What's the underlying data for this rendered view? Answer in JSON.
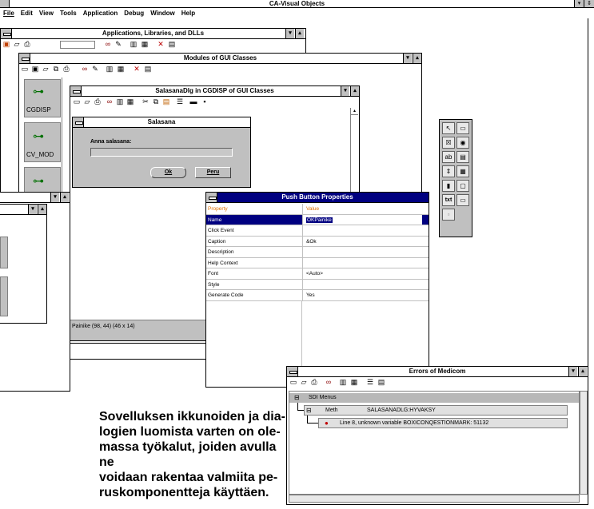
{
  "main": {
    "title": "CA-Visual Objects",
    "menu": [
      "File",
      "Edit",
      "View",
      "Tools",
      "Application",
      "Debug",
      "Window",
      "Help"
    ]
  },
  "app_lib": {
    "title": "Applications, Libraries, and DLLs"
  },
  "modules": {
    "title": "Modules of GUI Classes",
    "items": [
      "CGDISP",
      "CV_MOD"
    ]
  },
  "dialog_editor": {
    "title": "SalasanaDlg in CGDISP of GUI Classes",
    "status": "Painike (98, 44) (46 x 14)"
  },
  "salasana_dialog": {
    "title": "Salasana",
    "prompt": "Anna salasana:",
    "ok": "Ok",
    "cancel": "Peru"
  },
  "properties": {
    "title": "Push Button Properties",
    "header_property": "Property",
    "header_value": "Value",
    "rows": [
      {
        "name": "Name",
        "value": "OKPainike"
      },
      {
        "name": "Click Event",
        "value": ""
      },
      {
        "name": "Caption",
        "value": "&Ok"
      },
      {
        "name": "Description",
        "value": ""
      },
      {
        "name": "Help Context",
        "value": ""
      },
      {
        "name": "Font",
        "value": "<Auto>"
      },
      {
        "name": "Style",
        "value": ""
      },
      {
        "name": "Generate Code",
        "value": "Yes"
      }
    ]
  },
  "errors": {
    "title": "Errors of Medicom",
    "tree": [
      {
        "label": "SDI Menus"
      },
      {
        "label": "Meth",
        "detail": "SALASANADLG:HYVAKSY"
      },
      {
        "label": "Line 8, unknown variable BOXICONQESTIONMARK: 51132"
      }
    ]
  },
  "caption_lines": [
    "Sovelluksen ikkunoiden ja dia-",
    "logien luomista varten on ole-",
    "massa työkalut, joiden avulla ne",
    "voidaan rakentaa valmiita pe-",
    "ruskomponentteja käyttäen."
  ],
  "tool_palette": [
    "pointer-icon",
    "groupbox-icon",
    "checkbox-icon",
    "radio-icon",
    "edit-icon",
    "listbox-icon",
    "scrollbar-icon",
    "combo-icon",
    "spinner-icon",
    "rectangle-icon",
    "text-icon",
    "button-icon",
    "image-icon"
  ],
  "tool_labels": [
    "↖",
    "▭",
    "☒",
    "◉",
    "ab",
    "▤",
    "⇕",
    "▦",
    "▮",
    "▢",
    "txt",
    "▭",
    "▫"
  ]
}
